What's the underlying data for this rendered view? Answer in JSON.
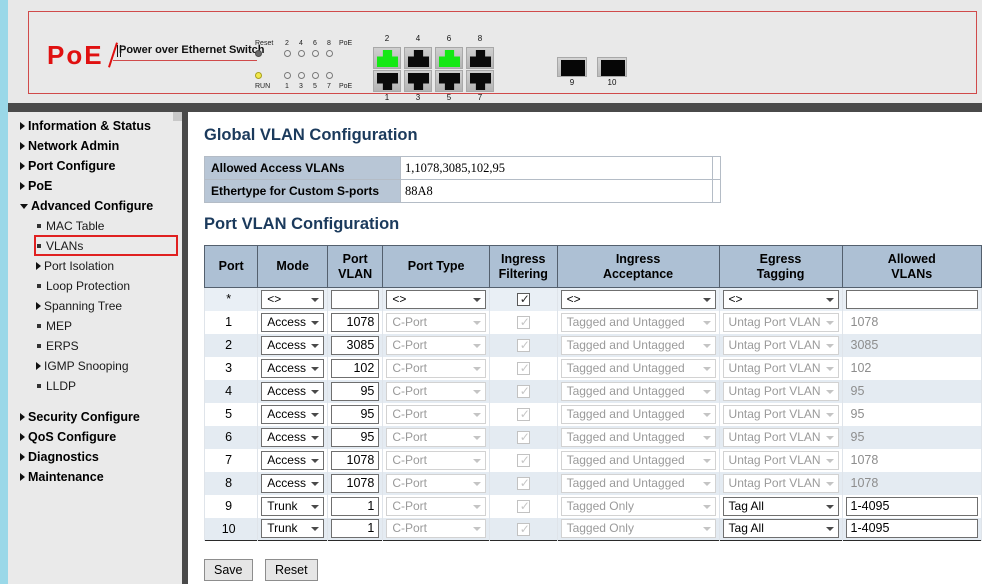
{
  "banner": {
    "logo_text": "PoE",
    "tagline": "Power over Ethernet Switch",
    "led_labels": {
      "reset": "Reset",
      "run": "RUN",
      "poe_top": "PoE",
      "poe_bottom": "PoE",
      "top_numbers": [
        "2",
        "4",
        "6",
        "8"
      ],
      "bottom_numbers": [
        "1",
        "3",
        "5",
        "7"
      ]
    },
    "ports": {
      "top_numbers": [
        "2",
        "4",
        "6",
        "8"
      ],
      "bottom_numbers": [
        "1",
        "3",
        "5",
        "7"
      ],
      "link_lit": [
        "2",
        "6"
      ],
      "uplink_numbers": [
        "9",
        "10"
      ]
    },
    "colors": {
      "border_red": "#d04a4a",
      "logo_red": "#e01010",
      "link_green": "#14e814",
      "run_amber": "#f2e84a",
      "strip_blue": "#9ad8e8"
    }
  },
  "sidebar": {
    "items": [
      {
        "label": "Information & Status",
        "level": "top",
        "marker": "arrow-right"
      },
      {
        "label": "Network Admin",
        "level": "top",
        "marker": "arrow-right"
      },
      {
        "label": "Port Configure",
        "level": "top",
        "marker": "arrow-right"
      },
      {
        "label": "PoE",
        "level": "top",
        "marker": "arrow-right"
      },
      {
        "label": "Advanced Configure",
        "level": "top",
        "marker": "arrow-down"
      },
      {
        "label": "MAC Table",
        "level": "sub",
        "marker": "bullet"
      },
      {
        "label": "VLANs",
        "level": "sub",
        "marker": "bullet",
        "selected": true
      },
      {
        "label": "Port Isolation",
        "level": "sub",
        "marker": "arrow-right"
      },
      {
        "label": "Loop Protection",
        "level": "sub",
        "marker": "bullet"
      },
      {
        "label": "Spanning Tree",
        "level": "sub",
        "marker": "arrow-right"
      },
      {
        "label": "MEP",
        "level": "sub",
        "marker": "bullet"
      },
      {
        "label": "ERPS",
        "level": "sub",
        "marker": "bullet"
      },
      {
        "label": "IGMP Snooping",
        "level": "sub",
        "marker": "arrow-right"
      },
      {
        "label": "LLDP",
        "level": "sub",
        "marker": "bullet"
      },
      {
        "label": "Security Configure",
        "level": "top",
        "marker": "arrow-right"
      },
      {
        "label": "QoS Configure",
        "level": "top",
        "marker": "arrow-right"
      },
      {
        "label": "Diagnostics",
        "level": "top",
        "marker": "arrow-right"
      },
      {
        "label": "Maintenance",
        "level": "top",
        "marker": "arrow-right"
      }
    ],
    "highlight_color": "#e02020"
  },
  "main": {
    "global_title": "Global VLAN Configuration",
    "global_rows": [
      {
        "label": "Allowed Access VLANs",
        "value": "1,1078,3085,102,95"
      },
      {
        "label": "Ethertype for Custom S-ports",
        "value": "88A8"
      }
    ],
    "port_title": "Port VLAN Configuration",
    "columns": [
      "Port",
      "Mode",
      "Port\nVLAN",
      "Port Type",
      "Ingress\nFiltering",
      "Ingress\nAcceptance",
      "Egress\nTagging",
      "Allowed\nVLANs"
    ],
    "columns_display": {
      "port": "Port",
      "mode": "Mode",
      "port_vlan_l1": "Port",
      "port_vlan_l2": "VLAN",
      "port_type": "Port Type",
      "ingress_filtering_l1": "Ingress",
      "ingress_filtering_l2": "Filtering",
      "ingress_acceptance_l1": "Ingress",
      "ingress_acceptance_l2": "Acceptance",
      "egress_tagging_l1": "Egress",
      "egress_tagging_l2": "Tagging",
      "allowed_vlans_l1": "Allowed",
      "allowed_vlans_l2": "VLANs"
    },
    "rows": [
      {
        "port": "*",
        "mode": "<>",
        "port_vlan": "",
        "port_type": "<>",
        "ingress_filtering": true,
        "ingress_acceptance": "<>",
        "egress_tagging": "<>",
        "allowed_vlans": "",
        "enabled": true
      },
      {
        "port": "1",
        "mode": "Access",
        "port_vlan": "1078",
        "port_type": "C-Port",
        "ingress_filtering": true,
        "ingress_acceptance": "Tagged and Untagged",
        "egress_tagging": "Untag Port VLAN",
        "allowed_vlans": "1078",
        "enabled": false
      },
      {
        "port": "2",
        "mode": "Access",
        "port_vlan": "3085",
        "port_type": "C-Port",
        "ingress_filtering": true,
        "ingress_acceptance": "Tagged and Untagged",
        "egress_tagging": "Untag Port VLAN",
        "allowed_vlans": "3085",
        "enabled": false
      },
      {
        "port": "3",
        "mode": "Access",
        "port_vlan": "102",
        "port_type": "C-Port",
        "ingress_filtering": true,
        "ingress_acceptance": "Tagged and Untagged",
        "egress_tagging": "Untag Port VLAN",
        "allowed_vlans": "102",
        "enabled": false
      },
      {
        "port": "4",
        "mode": "Access",
        "port_vlan": "95",
        "port_type": "C-Port",
        "ingress_filtering": true,
        "ingress_acceptance": "Tagged and Untagged",
        "egress_tagging": "Untag Port VLAN",
        "allowed_vlans": "95",
        "enabled": false
      },
      {
        "port": "5",
        "mode": "Access",
        "port_vlan": "95",
        "port_type": "C-Port",
        "ingress_filtering": true,
        "ingress_acceptance": "Tagged and Untagged",
        "egress_tagging": "Untag Port VLAN",
        "allowed_vlans": "95",
        "enabled": false
      },
      {
        "port": "6",
        "mode": "Access",
        "port_vlan": "95",
        "port_type": "C-Port",
        "ingress_filtering": true,
        "ingress_acceptance": "Tagged and Untagged",
        "egress_tagging": "Untag Port VLAN",
        "allowed_vlans": "95",
        "enabled": false
      },
      {
        "port": "7",
        "mode": "Access",
        "port_vlan": "1078",
        "port_type": "C-Port",
        "ingress_filtering": true,
        "ingress_acceptance": "Tagged and Untagged",
        "egress_tagging": "Untag Port VLAN",
        "allowed_vlans": "1078",
        "enabled": false
      },
      {
        "port": "8",
        "mode": "Access",
        "port_vlan": "1078",
        "port_type": "C-Port",
        "ingress_filtering": true,
        "ingress_acceptance": "Tagged and Untagged",
        "egress_tagging": "Untag Port VLAN",
        "allowed_vlans": "1078",
        "enabled": false
      },
      {
        "port": "9",
        "mode": "Trunk",
        "port_vlan": "1",
        "port_type": "C-Port",
        "ingress_filtering": true,
        "ingress_acceptance": "Tagged Only",
        "egress_tagging": "Tag All",
        "allowed_vlans": "1-4095",
        "enabled": true
      },
      {
        "port": "10",
        "mode": "Trunk",
        "port_vlan": "1",
        "port_type": "C-Port",
        "ingress_filtering": true,
        "ingress_acceptance": "Tagged Only",
        "egress_tagging": "Tag All",
        "allowed_vlans": "1-4095",
        "enabled": true
      }
    ],
    "buttons": {
      "save": "Save",
      "reset": "Reset"
    },
    "title_color": "#1b3a5c",
    "header_bg": "#adc0d4"
  }
}
